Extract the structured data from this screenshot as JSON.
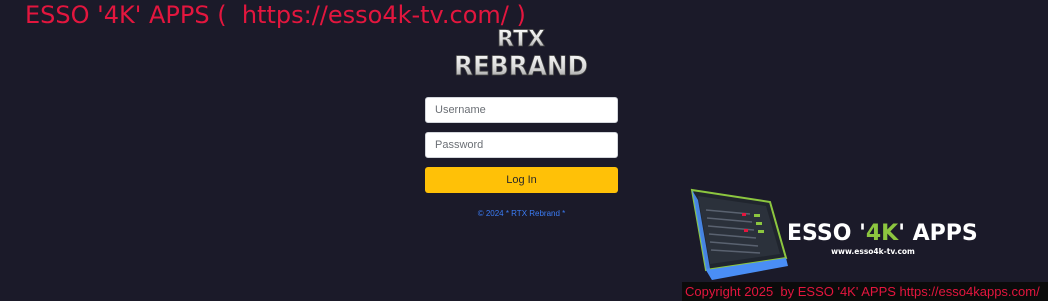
{
  "watermark": {
    "text": "ESSO '4K' APPS (  https://esso4k-tv.com/ )"
  },
  "logo": {
    "line1": "RTX",
    "line2": "REBRAND"
  },
  "login": {
    "username_placeholder": "Username",
    "password_placeholder": "Password",
    "button_label": "Log In"
  },
  "footer": {
    "copyright": "© 2024 * RTX Rebrand *"
  },
  "badge": {
    "brand_part1": "ESSO '",
    "brand_4k": "4K",
    "brand_part2": "' APPS",
    "website": "www.esso4k-tv.com"
  },
  "copyright_bar": {
    "text": "Copyright 2025  by ESSO '4K' APPS https://esso4kapps.com/"
  },
  "colors": {
    "background": "#1b1a29",
    "watermark": "#e3163e",
    "login_button": "#ffc107",
    "footer_link": "#3b7cf5",
    "badge_accent": "#8cc63f",
    "badge_monitor": "#4a8ef5"
  }
}
